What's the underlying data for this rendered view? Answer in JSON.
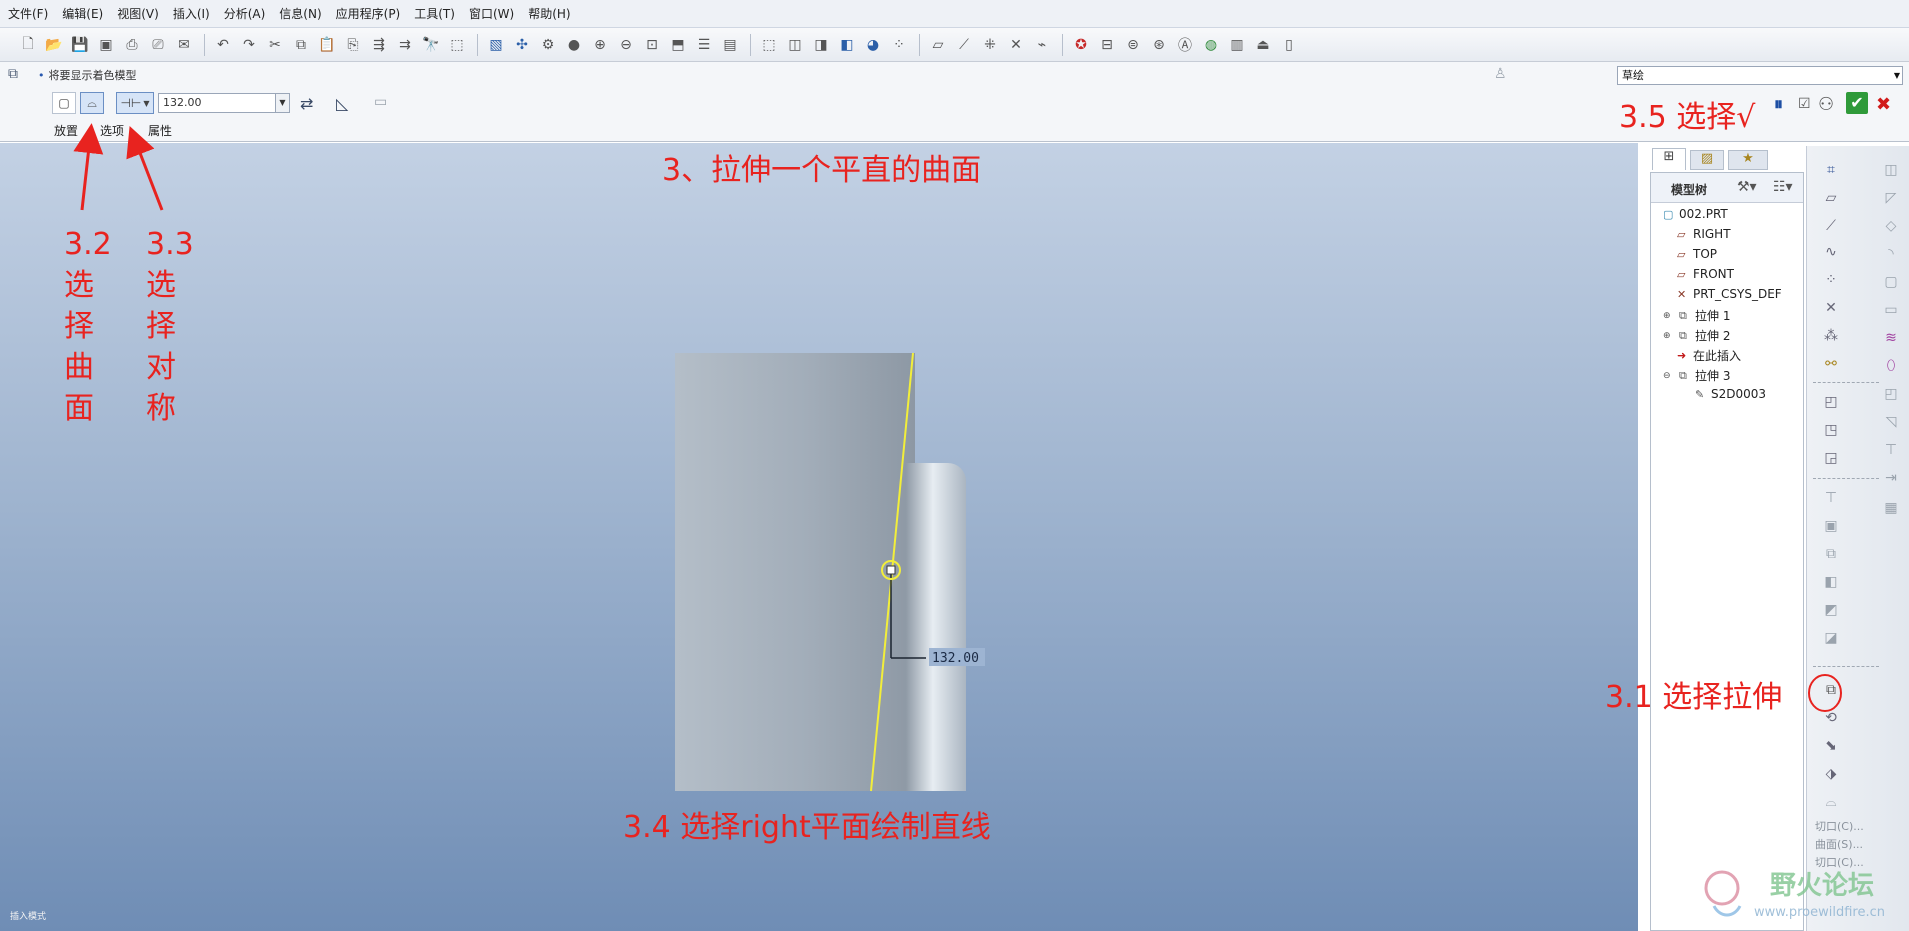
{
  "menu": [
    "文件(F)",
    "编辑(E)",
    "视图(V)",
    "插入(I)",
    "分析(A)",
    "信息(N)",
    "应用程序(P)",
    "工具(T)",
    "窗口(W)",
    "帮助(H)"
  ],
  "dashboard": {
    "message": "将要显示着色模型",
    "depth_value": "132.00",
    "tabs": [
      "放置",
      "选项",
      "属性"
    ],
    "sketch_select": "草绘"
  },
  "viewport": {
    "dimension_label": "132.00",
    "mode_text": "插入模式"
  },
  "model_tree": {
    "title": "模型树",
    "items": [
      {
        "label": "002.PRT",
        "icon": "part-icon"
      },
      {
        "label": "RIGHT",
        "icon": "datum-plane-icon"
      },
      {
        "label": "TOP",
        "icon": "datum-plane-icon"
      },
      {
        "label": "FRONT",
        "icon": "datum-plane-icon"
      },
      {
        "label": "PRT_CSYS_DEF",
        "icon": "csys-icon"
      },
      {
        "label": "拉伸 1",
        "icon": "extrude-icon"
      },
      {
        "label": "拉伸 2",
        "icon": "extrude-icon"
      },
      {
        "label": "在此插入",
        "icon": "insert-here-arrow-icon"
      },
      {
        "label": "拉伸 3",
        "icon": "extrude-icon"
      },
      {
        "label": "S2D0003",
        "icon": "sketch-icon"
      }
    ]
  },
  "right_toolbar_labels": [
    "切口(C)...",
    "曲面(S)...",
    "切口(C)..."
  ],
  "annotations": {
    "title": "3、拉伸一个平直的曲面",
    "step_3_1": "3.1 选择拉伸",
    "step_3_2": "3.2\n选\n择\n曲\n面",
    "step_3_3": "3.3\n选\n择\n对\n称",
    "step_3_4": "3.4 选择right平面绘制直线",
    "step_3_5": "3.5 选择√"
  },
  "watermark": {
    "name": "野火论坛",
    "url": "www.proewildfire.cn"
  },
  "colors": {
    "annotation_red": "#e8231f",
    "sketch_yellow": "#f2ee3a",
    "accept_green": "#2f9a3a"
  }
}
